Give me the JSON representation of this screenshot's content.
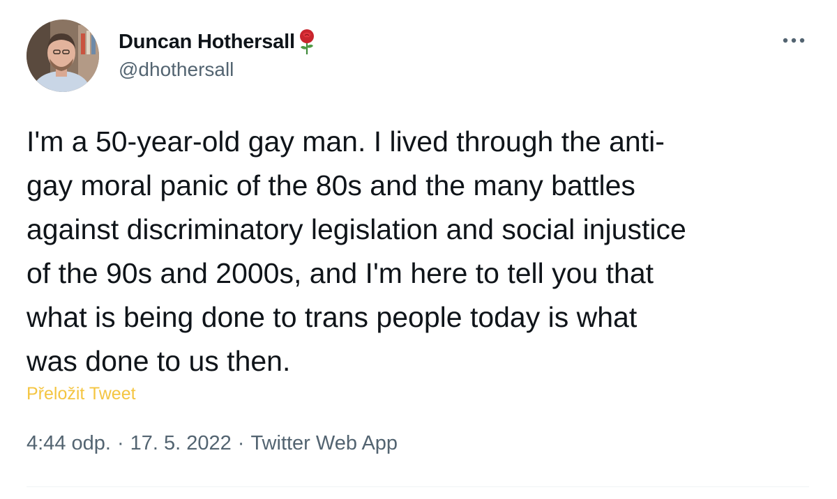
{
  "author": {
    "display_name": "Duncan Hothersall",
    "handle": "@dhothersall",
    "name_icon": "rose-icon",
    "avatar_icon": "profile-photo"
  },
  "tweet": {
    "text": "I'm a 50-year-old gay man. I lived through the anti-\ngay moral panic of the 80s and the many battles\nagainst discriminatory legislation and social injustice\nof the 90s and 2000s, and I'm here to tell you that\nwhat is being done to trans people today is what\nwas done to us then.",
    "translate_label": "Přeložit Tweet"
  },
  "meta": {
    "time": "4:44 odp.",
    "separator": "·",
    "date": "17. 5. 2022",
    "source": "Twitter Web App"
  },
  "more_icon": "more-horizontal-icon",
  "colors": {
    "text": "#0f1419",
    "secondary": "#536471",
    "translate": "#f4c542"
  }
}
